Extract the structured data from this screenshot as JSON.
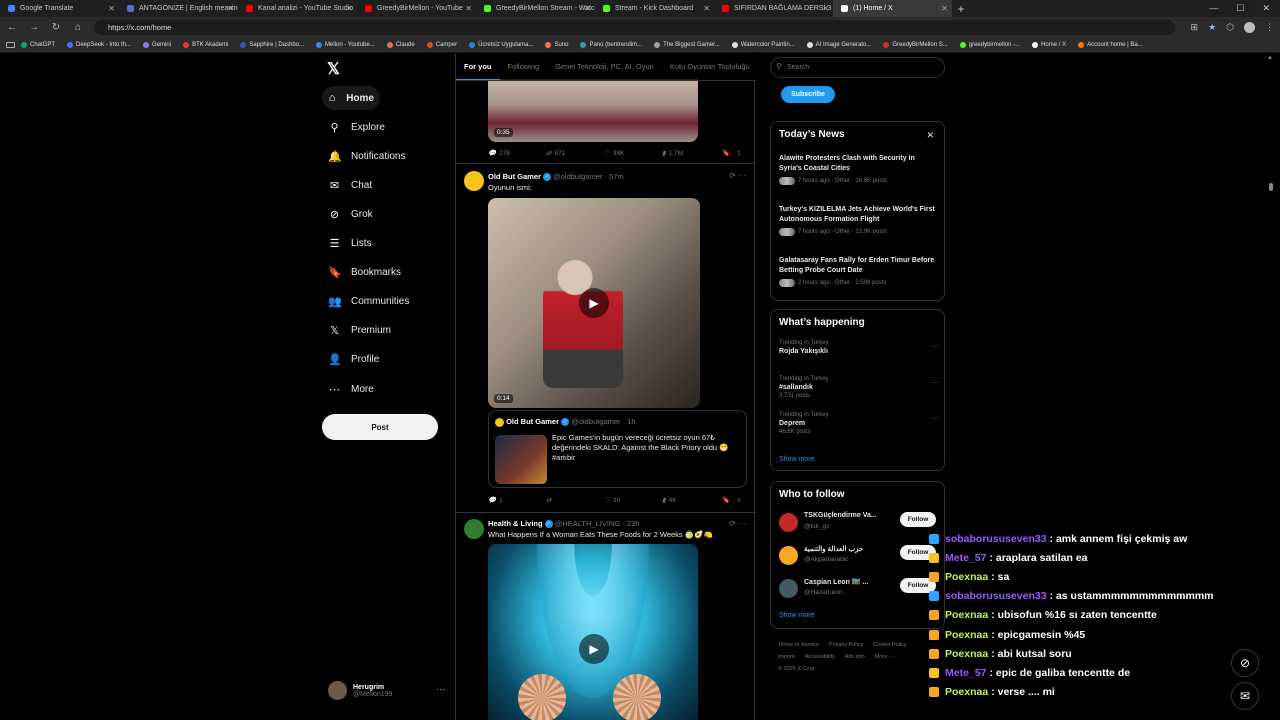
{
  "browser": {
    "tabs": [
      {
        "label": "Google Translate",
        "color": "#4285f4",
        "active": false
      },
      {
        "label": "ANTAGONIZE | English meaning -",
        "color": "#5a6ec8",
        "active": false
      },
      {
        "label": "Kanal analizi - YouTube Studio",
        "color": "#ff0000",
        "active": false
      },
      {
        "label": "GreedyBirMellon - YouTube",
        "color": "#ff0000",
        "active": false
      },
      {
        "label": "GreedyBirMellon Stream - Watch",
        "color": "#53fc18",
        "active": false
      },
      {
        "label": "Stream - Kick Dashboard",
        "color": "#53fc18",
        "active": false
      },
      {
        "label": "SIFIRDAN BAĞLAMA DERSİ 3 (EN",
        "color": "#ff0000",
        "active": false
      },
      {
        "label": "(1) Home / X",
        "color": "#ffffff",
        "active": true
      }
    ],
    "url": "https://x.com/home",
    "bookmarks": [
      "ChatGPT",
      "DeepSeek - Into th...",
      "Gemini",
      "BTK Akademi",
      "Sapphire | Dashbo...",
      "Mellon - Youtube...",
      "Claude",
      "Camper",
      "Ücretsiz Uygulama...",
      "Suno",
      "Pano (bentrendim...",
      "The Biggest Gamer...",
      "Watercolor Paintin...",
      "AI Image Generato...",
      "GreedyBirMellon S...",
      "greedybirmellon -...",
      "Home / X",
      "Account home | Ba..."
    ]
  },
  "sidebar": {
    "logo": "𝕏",
    "items": [
      {
        "label": "Home",
        "icon": "⌂"
      },
      {
        "label": "Explore",
        "icon": "⚲"
      },
      {
        "label": "Notifications",
        "icon": "🔔"
      },
      {
        "label": "Chat",
        "icon": "✉"
      },
      {
        "label": "Grok",
        "icon": "⊘"
      },
      {
        "label": "Lists",
        "icon": "☰"
      },
      {
        "label": "Bookmarks",
        "icon": "🔖"
      },
      {
        "label": "Communities",
        "icon": "👥"
      },
      {
        "label": "Premium",
        "icon": "𝕏"
      },
      {
        "label": "Profile",
        "icon": "👤"
      },
      {
        "label": "More",
        "icon": "⋯"
      }
    ],
    "post_label": "Post",
    "account": {
      "name": "Herugrim",
      "handle": "@Mellon199"
    }
  },
  "feed": {
    "tabs": [
      "For you",
      "Following",
      "Genel Teknoloji, PC, AI, Oyun",
      "Kutu Oyunları Topluluğu"
    ],
    "post0": {
      "duration": "0:35",
      "replies": "278",
      "reposts": "971",
      "likes": "38K",
      "views": "1.7M"
    },
    "post1": {
      "name": "Old But Gamer",
      "handle": "@oldbutgamer",
      "time": "· 57m",
      "text": "Oyunun ismi:",
      "duration": "0:14",
      "quote": {
        "name": "Old But Gamer",
        "handle": "@oldbutgamer",
        "time": "· 1h",
        "text": "Epic Games'in bugün vereceği ücretsiz oyun 67₺ değerindeki SKALD: Against the Black Priory oldu 😁 #artıbir"
      },
      "replies": "1",
      "reposts": "",
      "likes": "30",
      "views": "4K"
    },
    "post2": {
      "name": "Health & Living",
      "handle": "@HEALTH_LIVING",
      "time": "· 23h",
      "text": "What Happens If a Woman Eats These Foods for 2 Weeks 🍈🥑🍋"
    }
  },
  "right": {
    "search_placeholder": "Search",
    "subscribe": "Subscribe",
    "news": {
      "title": "Today’s News",
      "items": [
        {
          "headline": "Alawite Protesters Clash with Security in Syria's Coastal Cities",
          "meta": "7 hours ago · Other · 16.6K posts"
        },
        {
          "headline": "Turkey's KIZILELMA Jets Achieve World's First Autonomous Formation Flight",
          "meta": "7 hours ago · Other · 12.9K posts"
        },
        {
          "headline": "Galatasaray Fans Rally for Erden Timur Before Betting Probe Court Date",
          "meta": "2 hours ago · Other · 2,599 posts"
        }
      ]
    },
    "happening": {
      "title": "What’s happening",
      "items": [
        {
          "context": "Trending in Turkey",
          "topic": "Rojda Yakışıklı",
          "count": ""
        },
        {
          "context": "Trending in Turkey",
          "topic": "#sallandık",
          "count": "3,731 posts"
        },
        {
          "context": "Trending in Turkey",
          "topic": "Deprem",
          "count": "46.8K posts"
        }
      ],
      "show_more": "Show more"
    },
    "who": {
      "title": "Who to follow",
      "items": [
        {
          "name": "TSKGüçlendirme Va...",
          "handle": "@tsk_gv",
          "button": "Follow"
        },
        {
          "name": "حزب العدالة والتنمية",
          "handle": "@Akpartiarabic",
          "button": "Follow"
        },
        {
          "name": "Caspian Leon 🇦🇿 ...",
          "handle": "@HazarLeon",
          "button": "Follow"
        }
      ],
      "show_more": "Show more"
    },
    "footer": [
      "Terms of Service",
      "Privacy Policy",
      "Cookie Policy",
      "Imprint",
      "Accessibility",
      "Ads info",
      "More ···",
      "© 2025 X Corp."
    ]
  },
  "chat": [
    {
      "user": "sobaborususeven33",
      "text": ": amk annem fişi çekmiş aw",
      "color": "#9b59ff",
      "badge": "b2"
    },
    {
      "user": "Mete_57",
      "text": ": araplara satilan ea",
      "color": "#9b59ff",
      "badge": "b3"
    },
    {
      "user": "Poexnaa",
      "text": ": sa",
      "color": "#c5f05a",
      "badge": "b1"
    },
    {
      "user": "sobaborususeven33",
      "text": ": as ustammmmmmmmmmmmm",
      "color": "#9b59ff",
      "badge": "b2"
    },
    {
      "user": "Poexnaa",
      "text": ": ubisofun %16 sı zaten tencentte",
      "color": "#c5f05a",
      "badge": "b1"
    },
    {
      "user": "Poexnaa",
      "text": ": epicgamesin %45",
      "color": "#c5f05a",
      "badge": "b1"
    },
    {
      "user": "Poexnaa",
      "text": ": abi kutsal soru",
      "color": "#c5f05a",
      "badge": "b1"
    },
    {
      "user": "Mete_57",
      "text": ": epic de galiba tencentte de",
      "color": "#9b59ff",
      "badge": "b3"
    },
    {
      "user": "Poexnaa",
      "text": ": verse .... mi",
      "color": "#c5f05a",
      "badge": "b1"
    }
  ]
}
